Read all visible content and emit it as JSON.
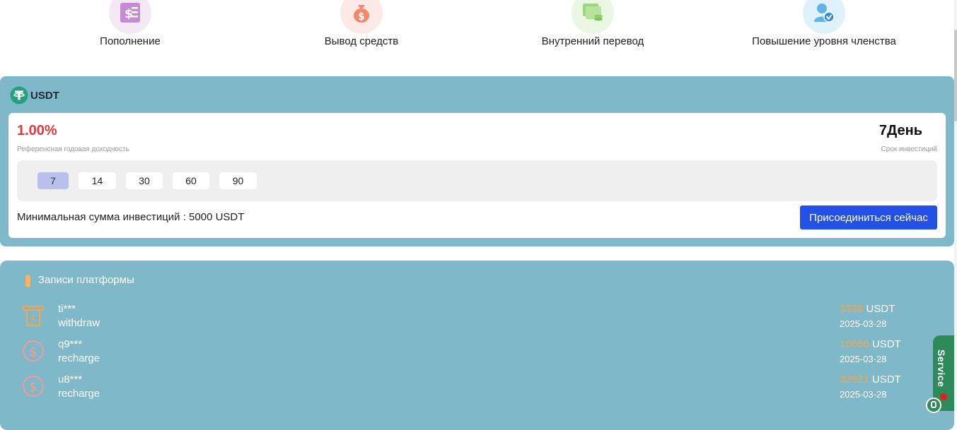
{
  "actions": [
    {
      "label": "Пополнение",
      "icon": "recharge-receipt-icon"
    },
    {
      "label": "Вывод средств",
      "icon": "money-bag-icon"
    },
    {
      "label": "Внутренний перевод",
      "icon": "transfer-wallet-icon"
    },
    {
      "label": "Повышение уровня членства",
      "icon": "member-upgrade-icon"
    }
  ],
  "product": {
    "coin": "USDT",
    "rate": "1.00%",
    "rate_label": "Референсная годовая доходность",
    "term": "7День",
    "term_label": "Срок инвестиций",
    "term_options": [
      "7",
      "14",
      "30",
      "60",
      "90"
    ],
    "selected_term": "7",
    "min_amount": "Минимальная сумма инвестиций : 5000 USDT",
    "join_label": "Присоединиться сейчас"
  },
  "records": {
    "title": "Записи платформы",
    "items": [
      {
        "user": "ti***",
        "type": "withdraw",
        "amount": "3338",
        "unit": "USDT",
        "date": "2025-03-28"
      },
      {
        "user": "q9***",
        "type": "recharge",
        "amount": "10666",
        "unit": "USDT",
        "date": "2025-03-28"
      },
      {
        "user": "u8***",
        "type": "recharge",
        "amount": "32521",
        "unit": "USDT",
        "date": "2025-03-28"
      }
    ]
  },
  "service": {
    "label": "Service"
  },
  "colors": {
    "panel": "#7fb8c9",
    "accent_red": "#e4393c",
    "button_blue": "#2350e6",
    "amount_orange": "#f5a54a",
    "active_term": "#b9c0ee",
    "service_green": "#2f8a59"
  }
}
